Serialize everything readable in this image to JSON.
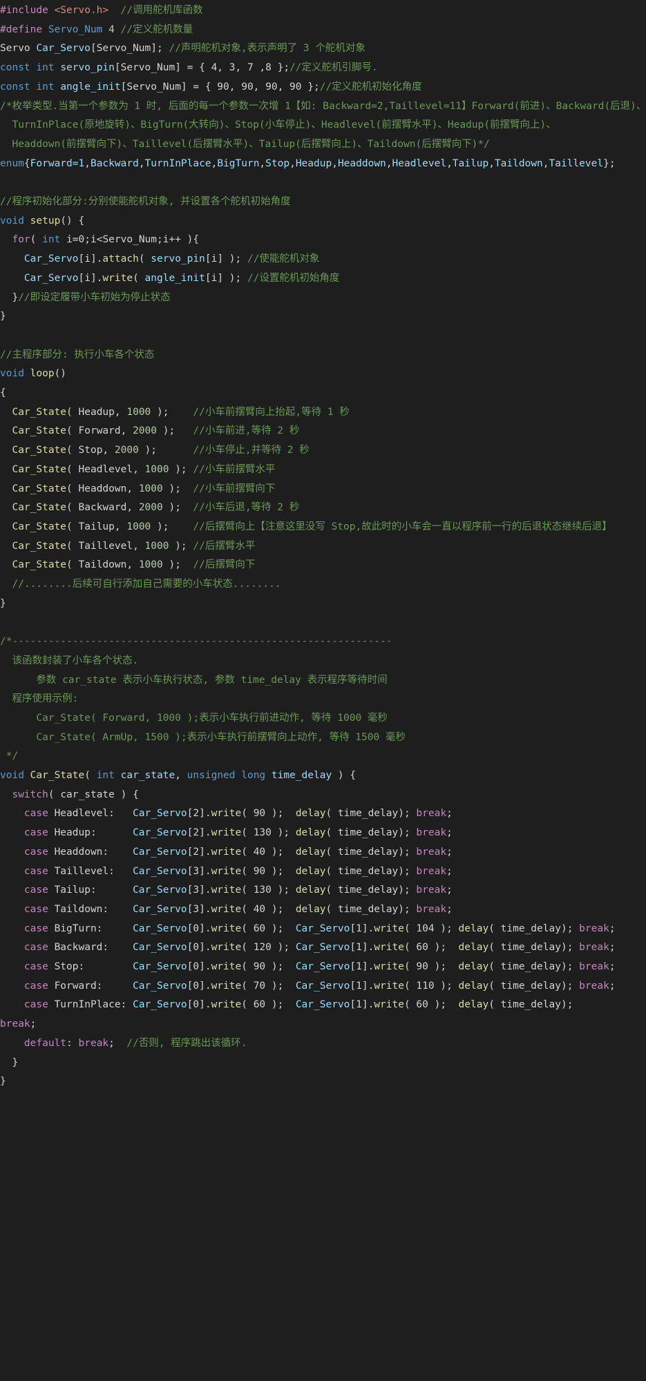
{
  "lines": [
    [
      {
        "t": "#include ",
        "c": "preproc"
      },
      {
        "t": "<Servo.h>",
        "c": "string"
      },
      {
        "t": "  //调用舵机库函数",
        "c": "comment"
      }
    ],
    [
      {
        "t": "#define ",
        "c": "preproc"
      },
      {
        "t": "Servo_Num",
        "c": "keyword"
      },
      {
        "t": " 4 ",
        "c": "number"
      },
      {
        "t": "//定义舵机数量",
        "c": "comment"
      }
    ],
    [
      {
        "t": "Servo ",
        "c": "text"
      },
      {
        "t": "Car_Servo",
        "c": "var"
      },
      {
        "t": "[Servo_Num]; ",
        "c": "text"
      },
      {
        "t": "//声明舵机对象,表示声明了 3 个舵机对象",
        "c": "comment"
      }
    ],
    [
      {
        "t": "const int ",
        "c": "keyword"
      },
      {
        "t": "servo_pin",
        "c": "var"
      },
      {
        "t": "[Servo_Num] = { 4, 3, 7 ,8 };",
        "c": "text"
      },
      {
        "t": "//定义舵机引脚号.",
        "c": "comment"
      }
    ],
    [
      {
        "t": "const int ",
        "c": "keyword"
      },
      {
        "t": "angle_init",
        "c": "var"
      },
      {
        "t": "[Servo_Num] = { 90, 90, 90, 90 };",
        "c": "text"
      },
      {
        "t": "//定义舵机初始化角度",
        "c": "comment"
      }
    ],
    [
      {
        "t": "/*枚举类型.当第一个参数为 1 时, 后面的每一个参数一次增 1【如: Backward=2,Taillevel=11】Forward(前进)、Backward(后退)、",
        "c": "comment"
      }
    ],
    [
      {
        "t": "  TurnInPlace(原地旋转)、BigTurn(大转向)、Stop(小车停止)、Headlevel(前摆臂水平)、Headup(前摆臂向上)、",
        "c": "comment"
      }
    ],
    [
      {
        "t": "  Headdown(前摆臂向下)、Taillevel(后摆臂水平)、Tailup(后摆臂向上)、Taildown(后摆臂向下)*/",
        "c": "comment"
      }
    ],
    [
      {
        "t": "enum",
        "c": "keyword"
      },
      {
        "t": "{",
        "c": "text"
      },
      {
        "t": "Forward=1",
        "c": "var"
      },
      {
        "t": ",",
        "c": "text"
      },
      {
        "t": "Backward",
        "c": "var"
      },
      {
        "t": ",",
        "c": "text"
      },
      {
        "t": "TurnInPlace",
        "c": "var"
      },
      {
        "t": ",",
        "c": "text"
      },
      {
        "t": "BigTurn",
        "c": "var"
      },
      {
        "t": ",",
        "c": "text"
      },
      {
        "t": "Stop",
        "c": "var"
      },
      {
        "t": ",",
        "c": "text"
      },
      {
        "t": "Headup",
        "c": "var"
      },
      {
        "t": ",",
        "c": "text"
      },
      {
        "t": "Headdown",
        "c": "var"
      },
      {
        "t": ",",
        "c": "text"
      },
      {
        "t": "Headlevel",
        "c": "var"
      },
      {
        "t": ",",
        "c": "text"
      },
      {
        "t": "Tailup",
        "c": "var"
      },
      {
        "t": ",",
        "c": "text"
      },
      {
        "t": "Taildown",
        "c": "var"
      },
      {
        "t": ",",
        "c": "text"
      },
      {
        "t": "Taillevel",
        "c": "var"
      },
      {
        "t": "};",
        "c": "text"
      }
    ],
    [],
    [
      {
        "t": "//程序初始化部分:分别使能舵机对象, 并设置各个舵机初始角度",
        "c": "comment"
      }
    ],
    [
      {
        "t": "void ",
        "c": "keyword"
      },
      {
        "t": "setup",
        "c": "func"
      },
      {
        "t": "() {",
        "c": "text"
      }
    ],
    [
      {
        "t": "  ",
        "c": "text"
      },
      {
        "t": "for",
        "c": "control"
      },
      {
        "t": "( ",
        "c": "text"
      },
      {
        "t": "int ",
        "c": "keyword"
      },
      {
        "t": "i=0;i<Servo_Num;i++ ){",
        "c": "text"
      }
    ],
    [
      {
        "t": "    ",
        "c": "text"
      },
      {
        "t": "Car_Servo",
        "c": "var"
      },
      {
        "t": "[i].",
        "c": "text"
      },
      {
        "t": "attach",
        "c": "func"
      },
      {
        "t": "( ",
        "c": "text"
      },
      {
        "t": "servo_pin",
        "c": "var"
      },
      {
        "t": "[i] ); ",
        "c": "text"
      },
      {
        "t": "//使能舵机对象",
        "c": "comment"
      }
    ],
    [
      {
        "t": "    ",
        "c": "text"
      },
      {
        "t": "Car_Servo",
        "c": "var"
      },
      {
        "t": "[i].",
        "c": "text"
      },
      {
        "t": "write",
        "c": "func"
      },
      {
        "t": "( ",
        "c": "text"
      },
      {
        "t": "angle_init",
        "c": "var"
      },
      {
        "t": "[i] ); ",
        "c": "text"
      },
      {
        "t": "//设置舵机初始角度",
        "c": "comment"
      }
    ],
    [
      {
        "t": "  }",
        "c": "text"
      },
      {
        "t": "//即设定履带小车初始为停止状态",
        "c": "comment"
      }
    ],
    [
      {
        "t": "}",
        "c": "text"
      }
    ],
    [],
    [
      {
        "t": "//主程序部分: 执行小车各个状态",
        "c": "comment"
      }
    ],
    [
      {
        "t": "void ",
        "c": "keyword"
      },
      {
        "t": "loop",
        "c": "func"
      },
      {
        "t": "()",
        "c": "text"
      }
    ],
    [
      {
        "t": "{",
        "c": "text"
      }
    ],
    [
      {
        "t": "  ",
        "c": "text"
      },
      {
        "t": "Car_State",
        "c": "func"
      },
      {
        "t": "( Headup, ",
        "c": "text"
      },
      {
        "t": "1000",
        "c": "number"
      },
      {
        "t": " );    ",
        "c": "text"
      },
      {
        "t": "//小车前摆臂向上抬起,等待 1 秒",
        "c": "comment"
      }
    ],
    [
      {
        "t": "  ",
        "c": "text"
      },
      {
        "t": "Car_State",
        "c": "func"
      },
      {
        "t": "( Forward, ",
        "c": "text"
      },
      {
        "t": "2000",
        "c": "number"
      },
      {
        "t": " );   ",
        "c": "text"
      },
      {
        "t": "//小车前进,等待 2 秒",
        "c": "comment"
      }
    ],
    [
      {
        "t": "  ",
        "c": "text"
      },
      {
        "t": "Car_State",
        "c": "func"
      },
      {
        "t": "( Stop, ",
        "c": "text"
      },
      {
        "t": "2000",
        "c": "number"
      },
      {
        "t": " );      ",
        "c": "text"
      },
      {
        "t": "//小车停止,并等待 2 秒",
        "c": "comment"
      }
    ],
    [
      {
        "t": "  ",
        "c": "text"
      },
      {
        "t": "Car_State",
        "c": "func"
      },
      {
        "t": "( Headlevel, ",
        "c": "text"
      },
      {
        "t": "1000",
        "c": "number"
      },
      {
        "t": " ); ",
        "c": "text"
      },
      {
        "t": "//小车前摆臂水平",
        "c": "comment"
      }
    ],
    [
      {
        "t": "  ",
        "c": "text"
      },
      {
        "t": "Car_State",
        "c": "func"
      },
      {
        "t": "( Headdown, ",
        "c": "text"
      },
      {
        "t": "1000",
        "c": "number"
      },
      {
        "t": " );  ",
        "c": "text"
      },
      {
        "t": "//小车前摆臂向下",
        "c": "comment"
      }
    ],
    [
      {
        "t": "  ",
        "c": "text"
      },
      {
        "t": "Car_State",
        "c": "func"
      },
      {
        "t": "( Backward, ",
        "c": "text"
      },
      {
        "t": "2000",
        "c": "number"
      },
      {
        "t": " );  ",
        "c": "text"
      },
      {
        "t": "//小车后退,等待 2 秒",
        "c": "comment"
      }
    ],
    [
      {
        "t": "  ",
        "c": "text"
      },
      {
        "t": "Car_State",
        "c": "func"
      },
      {
        "t": "( Tailup, ",
        "c": "text"
      },
      {
        "t": "1000",
        "c": "number"
      },
      {
        "t": " );    ",
        "c": "text"
      },
      {
        "t": "//后摆臂向上【注意这里没写 Stop,故此时的小车会一直以程序前一行的后退状态继续后退】",
        "c": "comment"
      }
    ],
    [
      {
        "t": "  ",
        "c": "text"
      },
      {
        "t": "Car_State",
        "c": "func"
      },
      {
        "t": "( Taillevel, ",
        "c": "text"
      },
      {
        "t": "1000",
        "c": "number"
      },
      {
        "t": " ); ",
        "c": "text"
      },
      {
        "t": "//后摆臂水平",
        "c": "comment"
      }
    ],
    [
      {
        "t": "  ",
        "c": "text"
      },
      {
        "t": "Car_State",
        "c": "func"
      },
      {
        "t": "( Taildown, ",
        "c": "text"
      },
      {
        "t": "1000",
        "c": "number"
      },
      {
        "t": " );  ",
        "c": "text"
      },
      {
        "t": "//后摆臂向下",
        "c": "comment"
      }
    ],
    [
      {
        "t": "  //........后续可自行添加自己需要的小车状态........",
        "c": "comment"
      }
    ],
    [
      {
        "t": "}",
        "c": "text"
      }
    ],
    [],
    [
      {
        "t": "/*---------------------------------------------------------------",
        "c": "comment"
      }
    ],
    [
      {
        "t": "  该函数封装了小车各个状态.",
        "c": "comment"
      }
    ],
    [
      {
        "t": "      参数 car_state 表示小车执行状态, 参数 time_delay 表示程序等待时间",
        "c": "comment"
      }
    ],
    [
      {
        "t": "  程序使用示例:",
        "c": "comment"
      }
    ],
    [
      {
        "t": "      Car_State( Forward, 1000 );表示小车执行前进动作, 等待 1000 毫秒",
        "c": "comment"
      }
    ],
    [
      {
        "t": "      Car_State( ArmUp, 1500 );表示小车执行前摆臂向上动作, 等待 1500 毫秒",
        "c": "comment"
      }
    ],
    [
      {
        "t": " */",
        "c": "comment"
      }
    ],
    [
      {
        "t": "void ",
        "c": "keyword"
      },
      {
        "t": "Car_State",
        "c": "func"
      },
      {
        "t": "( ",
        "c": "text"
      },
      {
        "t": "int ",
        "c": "keyword"
      },
      {
        "t": "car_state",
        "c": "var"
      },
      {
        "t": ", ",
        "c": "text"
      },
      {
        "t": "unsigned long ",
        "c": "keyword"
      },
      {
        "t": "time_delay",
        "c": "var"
      },
      {
        "t": " ) {",
        "c": "text"
      }
    ],
    [
      {
        "t": "  ",
        "c": "text"
      },
      {
        "t": "switch",
        "c": "control"
      },
      {
        "t": "( car_state ) {",
        "c": "text"
      }
    ],
    [
      {
        "t": "    ",
        "c": "text"
      },
      {
        "t": "case ",
        "c": "control"
      },
      {
        "t": "Headlevel:   ",
        "c": "text"
      },
      {
        "t": "Car_Servo",
        "c": "var"
      },
      {
        "t": "[2].",
        "c": "text"
      },
      {
        "t": "write",
        "c": "func"
      },
      {
        "t": "( 90 );  ",
        "c": "text"
      },
      {
        "t": "delay",
        "c": "func"
      },
      {
        "t": "( time_delay); ",
        "c": "text"
      },
      {
        "t": "break",
        "c": "control"
      },
      {
        "t": ";",
        "c": "text"
      }
    ],
    [
      {
        "t": "    ",
        "c": "text"
      },
      {
        "t": "case ",
        "c": "control"
      },
      {
        "t": "Headup:      ",
        "c": "text"
      },
      {
        "t": "Car_Servo",
        "c": "var"
      },
      {
        "t": "[2].",
        "c": "text"
      },
      {
        "t": "write",
        "c": "func"
      },
      {
        "t": "( 130 ); ",
        "c": "text"
      },
      {
        "t": "delay",
        "c": "func"
      },
      {
        "t": "( time_delay); ",
        "c": "text"
      },
      {
        "t": "break",
        "c": "control"
      },
      {
        "t": ";",
        "c": "text"
      }
    ],
    [
      {
        "t": "    ",
        "c": "text"
      },
      {
        "t": "case ",
        "c": "control"
      },
      {
        "t": "Headdown:    ",
        "c": "text"
      },
      {
        "t": "Car_Servo",
        "c": "var"
      },
      {
        "t": "[2].",
        "c": "text"
      },
      {
        "t": "write",
        "c": "func"
      },
      {
        "t": "( 40 );  ",
        "c": "text"
      },
      {
        "t": "delay",
        "c": "func"
      },
      {
        "t": "( time_delay); ",
        "c": "text"
      },
      {
        "t": "break",
        "c": "control"
      },
      {
        "t": ";",
        "c": "text"
      }
    ],
    [
      {
        "t": "    ",
        "c": "text"
      },
      {
        "t": "case ",
        "c": "control"
      },
      {
        "t": "Taillevel:   ",
        "c": "text"
      },
      {
        "t": "Car_Servo",
        "c": "var"
      },
      {
        "t": "[3].",
        "c": "text"
      },
      {
        "t": "write",
        "c": "func"
      },
      {
        "t": "( 90 );  ",
        "c": "text"
      },
      {
        "t": "delay",
        "c": "func"
      },
      {
        "t": "( time_delay); ",
        "c": "text"
      },
      {
        "t": "break",
        "c": "control"
      },
      {
        "t": ";",
        "c": "text"
      }
    ],
    [
      {
        "t": "    ",
        "c": "text"
      },
      {
        "t": "case ",
        "c": "control"
      },
      {
        "t": "Tailup:      ",
        "c": "text"
      },
      {
        "t": "Car_Servo",
        "c": "var"
      },
      {
        "t": "[3].",
        "c": "text"
      },
      {
        "t": "write",
        "c": "func"
      },
      {
        "t": "( 130 ); ",
        "c": "text"
      },
      {
        "t": "delay",
        "c": "func"
      },
      {
        "t": "( time_delay); ",
        "c": "text"
      },
      {
        "t": "break",
        "c": "control"
      },
      {
        "t": ";",
        "c": "text"
      }
    ],
    [
      {
        "t": "    ",
        "c": "text"
      },
      {
        "t": "case ",
        "c": "control"
      },
      {
        "t": "Taildown:    ",
        "c": "text"
      },
      {
        "t": "Car_Servo",
        "c": "var"
      },
      {
        "t": "[3].",
        "c": "text"
      },
      {
        "t": "write",
        "c": "func"
      },
      {
        "t": "( 40 );  ",
        "c": "text"
      },
      {
        "t": "delay",
        "c": "func"
      },
      {
        "t": "( time_delay); ",
        "c": "text"
      },
      {
        "t": "break",
        "c": "control"
      },
      {
        "t": ";",
        "c": "text"
      }
    ],
    [
      {
        "t": "    ",
        "c": "text"
      },
      {
        "t": "case ",
        "c": "control"
      },
      {
        "t": "BigTurn:     ",
        "c": "text"
      },
      {
        "t": "Car_Servo",
        "c": "var"
      },
      {
        "t": "[0].",
        "c": "text"
      },
      {
        "t": "write",
        "c": "func"
      },
      {
        "t": "( 60 );  ",
        "c": "text"
      },
      {
        "t": "Car_Servo",
        "c": "var"
      },
      {
        "t": "[1].",
        "c": "text"
      },
      {
        "t": "write",
        "c": "func"
      },
      {
        "t": "( 104 ); ",
        "c": "text"
      },
      {
        "t": "delay",
        "c": "func"
      },
      {
        "t": "( time_delay); ",
        "c": "text"
      },
      {
        "t": "break",
        "c": "control"
      },
      {
        "t": ";",
        "c": "text"
      }
    ],
    [
      {
        "t": "    ",
        "c": "text"
      },
      {
        "t": "case ",
        "c": "control"
      },
      {
        "t": "Backward:    ",
        "c": "text"
      },
      {
        "t": "Car_Servo",
        "c": "var"
      },
      {
        "t": "[0].",
        "c": "text"
      },
      {
        "t": "write",
        "c": "func"
      },
      {
        "t": "( 120 ); ",
        "c": "text"
      },
      {
        "t": "Car_Servo",
        "c": "var"
      },
      {
        "t": "[1].",
        "c": "text"
      },
      {
        "t": "write",
        "c": "func"
      },
      {
        "t": "( 60 );  ",
        "c": "text"
      },
      {
        "t": "delay",
        "c": "func"
      },
      {
        "t": "( time_delay); ",
        "c": "text"
      },
      {
        "t": "break",
        "c": "control"
      },
      {
        "t": ";",
        "c": "text"
      }
    ],
    [
      {
        "t": "    ",
        "c": "text"
      },
      {
        "t": "case ",
        "c": "control"
      },
      {
        "t": "Stop:        ",
        "c": "text"
      },
      {
        "t": "Car_Servo",
        "c": "var"
      },
      {
        "t": "[0].",
        "c": "text"
      },
      {
        "t": "write",
        "c": "func"
      },
      {
        "t": "( 90 );  ",
        "c": "text"
      },
      {
        "t": "Car_Servo",
        "c": "var"
      },
      {
        "t": "[1].",
        "c": "text"
      },
      {
        "t": "write",
        "c": "func"
      },
      {
        "t": "( 90 );  ",
        "c": "text"
      },
      {
        "t": "delay",
        "c": "func"
      },
      {
        "t": "( time_delay); ",
        "c": "text"
      },
      {
        "t": "break",
        "c": "control"
      },
      {
        "t": ";",
        "c": "text"
      }
    ],
    [
      {
        "t": "    ",
        "c": "text"
      },
      {
        "t": "case ",
        "c": "control"
      },
      {
        "t": "Forward:     ",
        "c": "text"
      },
      {
        "t": "Car_Servo",
        "c": "var"
      },
      {
        "t": "[0].",
        "c": "text"
      },
      {
        "t": "write",
        "c": "func"
      },
      {
        "t": "( 70 );  ",
        "c": "text"
      },
      {
        "t": "Car_Servo",
        "c": "var"
      },
      {
        "t": "[1].",
        "c": "text"
      },
      {
        "t": "write",
        "c": "func"
      },
      {
        "t": "( 110 ); ",
        "c": "text"
      },
      {
        "t": "delay",
        "c": "func"
      },
      {
        "t": "( time_delay); ",
        "c": "text"
      },
      {
        "t": "break",
        "c": "control"
      },
      {
        "t": ";",
        "c": "text"
      }
    ],
    [
      {
        "t": "    ",
        "c": "text"
      },
      {
        "t": "case ",
        "c": "control"
      },
      {
        "t": "TurnInPlace: ",
        "c": "text"
      },
      {
        "t": "Car_Servo",
        "c": "var"
      },
      {
        "t": "[0].",
        "c": "text"
      },
      {
        "t": "write",
        "c": "func"
      },
      {
        "t": "( 60 );  ",
        "c": "text"
      },
      {
        "t": "Car_Servo",
        "c": "var"
      },
      {
        "t": "[1].",
        "c": "text"
      },
      {
        "t": "write",
        "c": "func"
      },
      {
        "t": "( 60 );  ",
        "c": "text"
      },
      {
        "t": "delay",
        "c": "func"
      },
      {
        "t": "( time_delay);",
        "c": "text"
      }
    ],
    [
      {
        "t": "break",
        "c": "control"
      },
      {
        "t": ";",
        "c": "text"
      }
    ],
    [
      {
        "t": "    ",
        "c": "text"
      },
      {
        "t": "default",
        "c": "control"
      },
      {
        "t": ": ",
        "c": "text"
      },
      {
        "t": "break",
        "c": "control"
      },
      {
        "t": ";  ",
        "c": "text"
      },
      {
        "t": "//否则, 程序跳出该循环.",
        "c": "comment"
      }
    ],
    [
      {
        "t": "  }",
        "c": "text"
      }
    ],
    [
      {
        "t": "}",
        "c": "text"
      }
    ]
  ]
}
